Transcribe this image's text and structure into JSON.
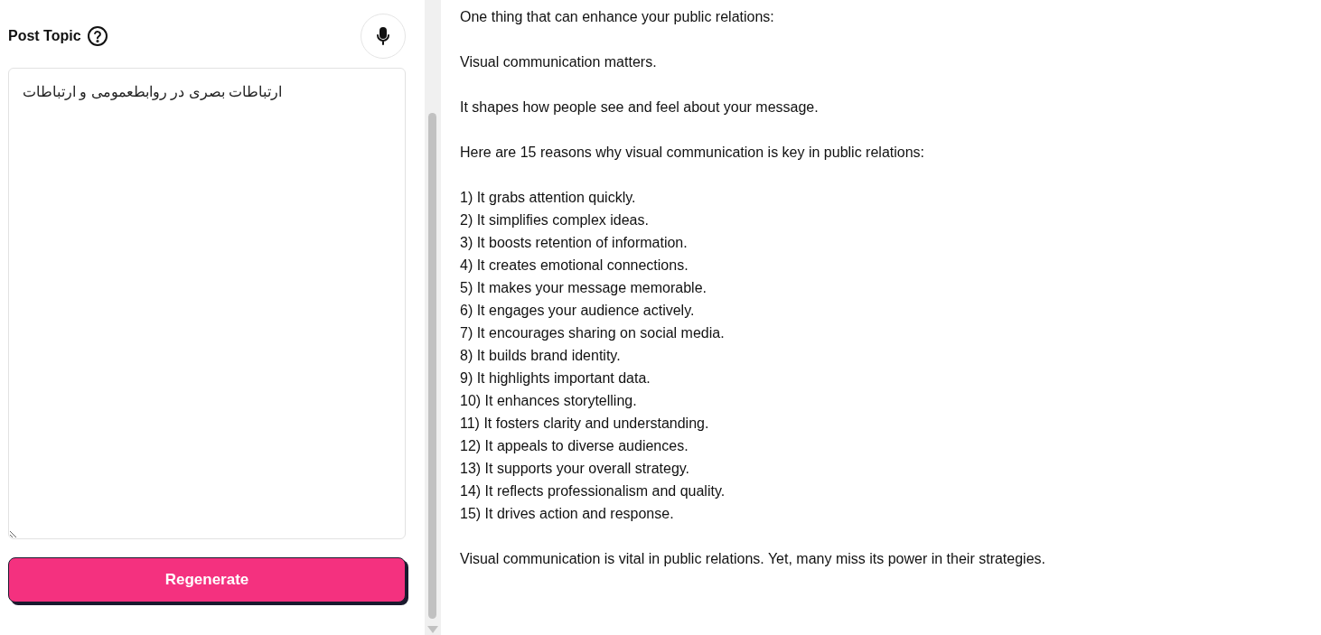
{
  "post_topic": {
    "label": "Post Topic",
    "value": "ارتباطات بصری در روابطعمومی و ارتباطات"
  },
  "regenerate_button": "Regenerate",
  "output": {
    "paragraphs": [
      [
        "One thing that can enhance your public relations:"
      ],
      [
        "Visual communication matters."
      ],
      [
        "It shapes how people see and feel about your message."
      ],
      [
        "Here are 15 reasons why visual communication is key in public relations:"
      ],
      [
        "1) It grabs attention quickly.",
        "2) It simplifies complex ideas.",
        "3) It boosts retention of information.",
        "4) It creates emotional connections.",
        "5) It makes your message memorable.",
        "6) It engages your audience actively.",
        "7) It encourages sharing on social media.",
        "8) It builds brand identity.",
        "9) It highlights important data.",
        "10) It enhances storytelling.",
        "11) It fosters clarity and understanding.",
        "12) It appeals to diverse audiences.",
        "13) It supports your overall strategy.",
        "14) It reflects professionalism and quality.",
        "15) It drives action and response."
      ],
      [
        "Visual communication is vital in public relations. Yet, many miss its power in their strategies."
      ]
    ]
  }
}
